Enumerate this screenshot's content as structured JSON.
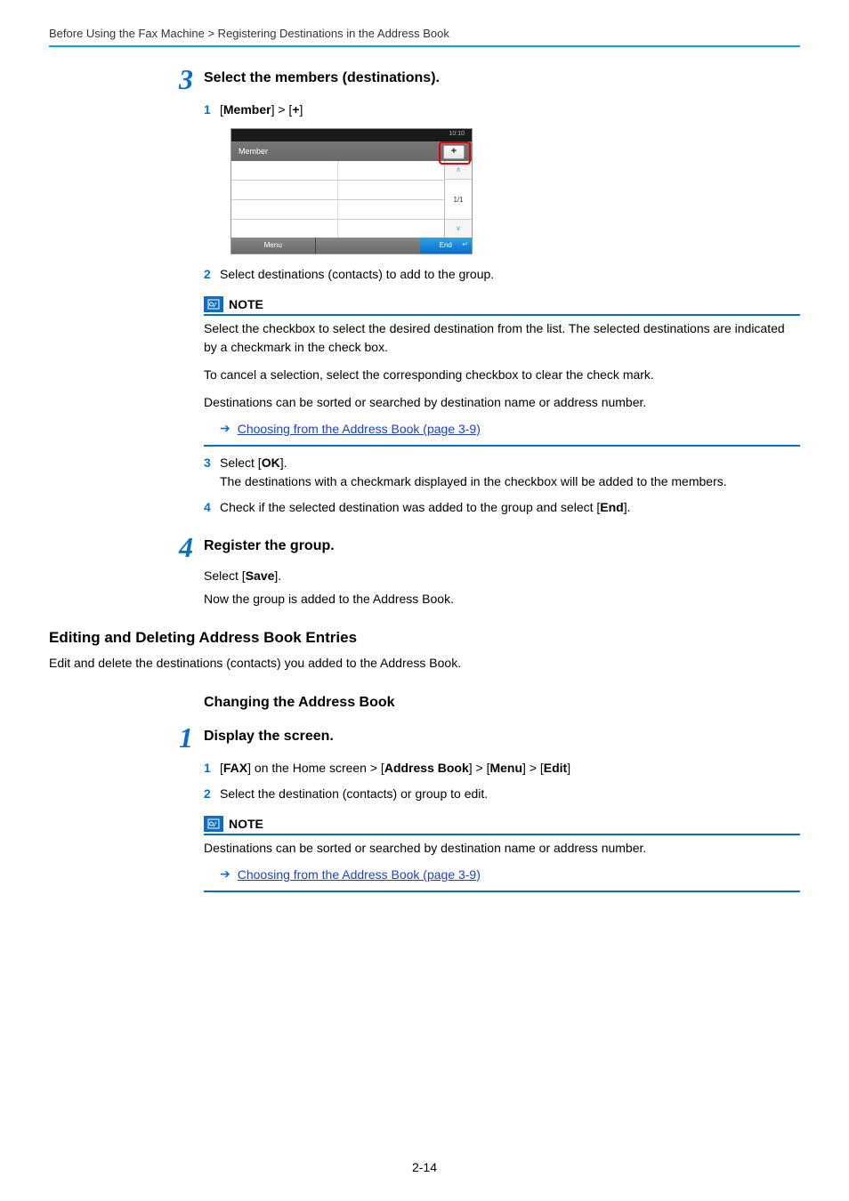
{
  "breadcrumb": "Before Using the Fax Machine > Registering Destinations in the Address Book",
  "step3": {
    "number": "3",
    "title": "Select the members (destinations).",
    "sub1_num": "1",
    "sub1_prefix": "[",
    "sub1_member": "Member",
    "sub1_mid": "] > [",
    "sub1_plus": "+",
    "sub1_suffix": "]",
    "device": {
      "time": "10:10",
      "header": "Member",
      "plus": "+",
      "page": "1/1",
      "up": "∧",
      "down": "∨",
      "menu": "Menu",
      "end": "End",
      "enter": "↵"
    },
    "sub2_num": "2",
    "sub2_text": "Select destinations (contacts) to add to the group.",
    "note": {
      "label": "NOTE",
      "p1": "Select the checkbox to select the desired destination from the list. The selected destinations are indicated by a checkmark in the check box.",
      "p2": "To cancel a selection, select the corresponding checkbox to clear the check mark.",
      "p3": "Destinations can be sorted or searched by destination name or address number.",
      "link": "Choosing from the Address Book (page 3-9)"
    },
    "sub3_num": "3",
    "sub3_l1a": "Select [",
    "sub3_l1b": "OK",
    "sub3_l1c": "].",
    "sub3_l2": "The destinations with a checkmark displayed in the checkbox will be added to the members.",
    "sub4_num": "4",
    "sub4_a": "Check if the selected destination was added to the group and select [",
    "sub4_b": "End",
    "sub4_c": "]."
  },
  "step4": {
    "number": "4",
    "title": "Register the group.",
    "p1a": "Select [",
    "p1b": "Save",
    "p1c": "].",
    "p2": "Now the group is added to the Address Book."
  },
  "section2": {
    "title": "Editing and Deleting Address Book Entries",
    "desc": "Edit and delete the destinations (contacts) you added to the Address Book.",
    "subheading": "Changing the Address Book"
  },
  "step1b": {
    "number": "1",
    "title": "Display the screen.",
    "sub1_num": "1",
    "sub1_pre": "[",
    "sub1_b1": "FAX",
    "sub1_m1": "] on the Home screen > [",
    "sub1_b2": "Address Book",
    "sub1_m2": "] > [",
    "sub1_b3": "Menu",
    "sub1_m3": "] > [",
    "sub1_b4": "Edit",
    "sub1_suf": "]",
    "sub2_num": "2",
    "sub2_text": "Select the destination (contacts) or group to edit.",
    "note": {
      "label": "NOTE",
      "p1": "Destinations can be sorted or searched by destination name or address number.",
      "link": "Choosing from the Address Book (page 3-9)"
    }
  },
  "pagenum": "2-14"
}
